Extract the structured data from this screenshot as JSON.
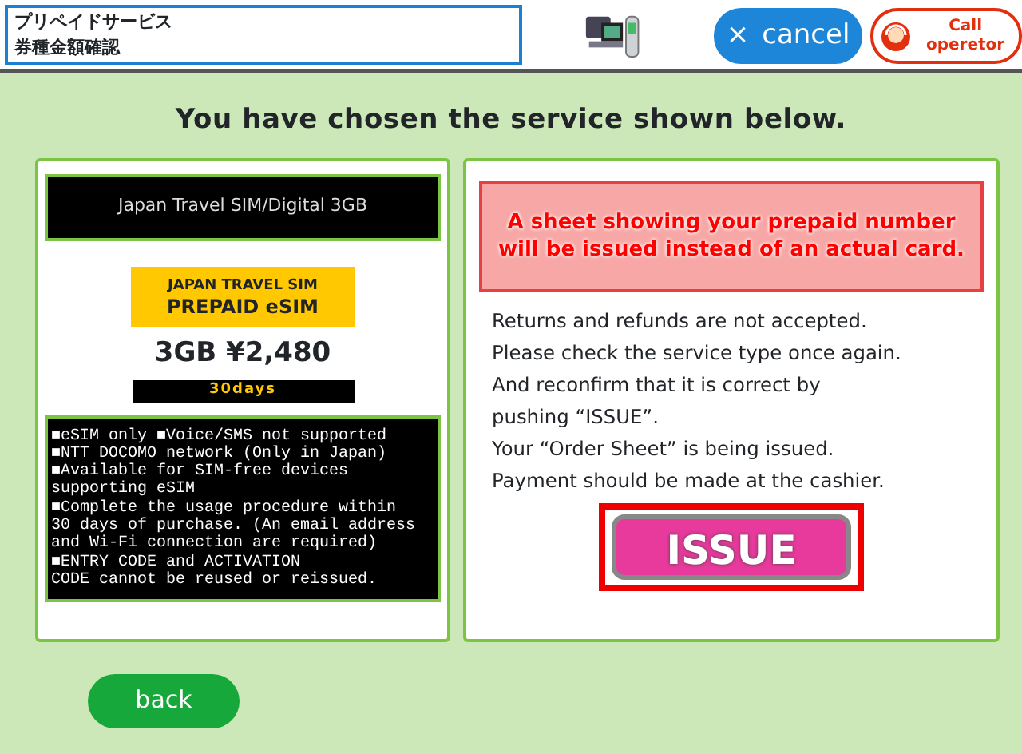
{
  "header": {
    "title_lines": [
      "プリペイドサービス",
      "券種金額確認"
    ],
    "cancel": {
      "icon": "×",
      "label": "cancel"
    },
    "operator": {
      "label_lines": [
        "Call",
        "operetor"
      ]
    }
  },
  "heading": "You have chosen the service shown below.",
  "product": {
    "name": "Japan Travel SIM/Digital 3GB",
    "logo_lines": [
      "JAPAN TRAVEL SIM",
      "PREPAID eSIM"
    ],
    "price": "3GB ¥2,480",
    "validity": "30days",
    "notes": [
      "■eSIM only ■Voice/SMS not supported",
      "■NTT DOCOMO network (Only in Japan)",
      "■Available for SIM-free devices",
      "supporting eSIM",
      "■Complete the usage procedure within",
      "30 days of purchase. (An email address",
      "and Wi-Fi connection are required)",
      "■ENTRY CODE and ACTIVATION",
      "CODE cannot be reused or reissued."
    ]
  },
  "notice": {
    "alert_lines": [
      "A sheet showing your prepaid number",
      "will be issued instead of an actual card."
    ],
    "lines": [
      "Returns and refunds are not accepted.",
      "Please check the service type once again.",
      "And reconfirm that it is correct by",
      "pushing “ISSUE”.",
      "Your “Order Sheet” is being issued.",
      "Payment should be made at the cashier."
    ],
    "issue_button": "ISSUE"
  },
  "back_button": "back"
}
